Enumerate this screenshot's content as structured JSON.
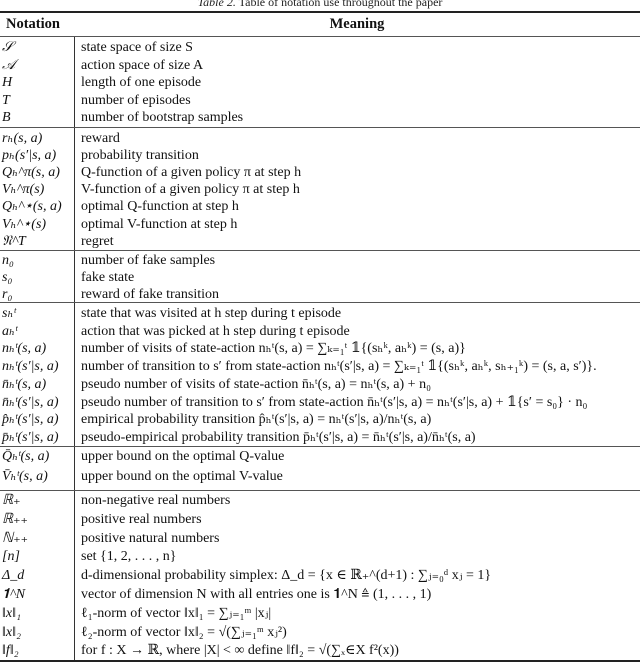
{
  "caption": {
    "label": "Table 2.",
    "text": "Table of notation use throughout the paper"
  },
  "header": {
    "notation": "Notation",
    "meaning": "Meaning"
  },
  "groups": [
    {
      "rows": [
        {
          "symbol": "𝒮",
          "meaning": "state space of size S"
        },
        {
          "symbol": "𝒜",
          "meaning": "action space of size A"
        },
        {
          "symbol": "H",
          "meaning": "length of one episode"
        },
        {
          "symbol": "T",
          "meaning": "number of episodes"
        },
        {
          "symbol": "B",
          "meaning": "number of bootstrap samples"
        }
      ]
    },
    {
      "rows": [
        {
          "symbol": "rₕ(s, a)",
          "meaning": "reward"
        },
        {
          "symbol": "pₕ(s′|s, a)",
          "meaning": "probability transition"
        },
        {
          "symbol": "Qₕ^π(s, a)",
          "meaning": "Q-function of a given policy π at step h"
        },
        {
          "symbol": "Vₕ^π(s)",
          "meaning": "V-function of a given policy π at step h"
        },
        {
          "symbol": "Qₕ^⋆(s, a)",
          "meaning": "optimal Q-function at step h"
        },
        {
          "symbol": "Vₕ^⋆(s)",
          "meaning": "optimal V-function at step h"
        },
        {
          "symbol": "𝔑^T",
          "meaning": "regret"
        }
      ]
    },
    {
      "rows": [
        {
          "symbol": "n₀",
          "meaning": "number of fake samples"
        },
        {
          "symbol": "s₀",
          "meaning": "fake state"
        },
        {
          "symbol": "r₀",
          "meaning": "reward of fake transition"
        }
      ]
    },
    {
      "rows": [
        {
          "symbol": "sₕᵗ",
          "meaning": "state that was visited at h step during t episode"
        },
        {
          "symbol": "aₕᵗ",
          "meaning": "action that was picked at h step during t episode"
        },
        {
          "symbol": "nₕᵗ(s, a)",
          "meaning": "number of visits of state-action nₕᵗ(s, a) = ∑ₖ₌₁ᵗ 𝟙{(sₕᵏ, aₕᵏ) = (s, a)}"
        },
        {
          "symbol": "nₕᵗ(s′|s, a)",
          "meaning": "number of transition to s′ from state-action nₕᵗ(s′|s, a) = ∑ₖ₌₁ᵗ 𝟙{(sₕᵏ, aₕᵏ, sₕ₊₁ᵏ) = (s, a, s′)}."
        },
        {
          "symbol": "n̄ₕᵗ(s, a)",
          "meaning": "pseudo number of visits of state-action n̄ₕᵗ(s, a) = nₕᵗ(s, a) + n₀"
        },
        {
          "symbol": "n̄ₕᵗ(s′|s, a)",
          "meaning": "pseudo number of transition to s′ from state-action n̄ₕᵗ(s′|s, a) = nₕᵗ(s′|s, a) + 𝟙{s′ = s₀} · n₀"
        },
        {
          "symbol": "p̂ₕᵗ(s′|s, a)",
          "meaning": "empirical probability transition p̂ₕᵗ(s′|s, a) = nₕᵗ(s′|s, a)/nₕᵗ(s, a)"
        },
        {
          "symbol": "p̄ₕᵗ(s′|s, a)",
          "meaning": "pseudo-empirical probability transition p̄ₕᵗ(s′|s, a) = n̄ₕᵗ(s′|s, a)/n̄ₕᵗ(s, a)"
        }
      ]
    },
    {
      "rows": [
        {
          "symbol": "Q̄ₕᵗ(s, a)",
          "meaning": "upper bound on the optimal Q-value"
        },
        {
          "symbol": "V̄ₕᵗ(s, a)",
          "meaning": "upper bound on the optimal V-value"
        }
      ]
    },
    {
      "rows": [
        {
          "symbol": "ℝ₊",
          "meaning": "non-negative real numbers"
        },
        {
          "symbol": "ℝ₊₊",
          "meaning": "positive real numbers"
        },
        {
          "symbol": "ℕ₊₊",
          "meaning": "positive natural numbers"
        },
        {
          "symbol": "[n]",
          "meaning": "set {1, 2, . . . , n}"
        },
        {
          "symbol": "Δ_d",
          "meaning": "d-dimensional probability simplex: Δ_d = {x ∈ ℝ₊^(d+1) : ∑ⱼ₌₀ᵈ xⱼ = 1}"
        },
        {
          "symbol": "𝟏^N",
          "meaning": "vector of dimension N with all entries one is 𝟏^N ≜ (1, . . . , 1)"
        },
        {
          "symbol": "‖x‖₁",
          "meaning": "ℓ₁-norm of vector ‖x‖₁ = ∑ⱼ₌₁ᵐ |xⱼ|"
        },
        {
          "symbol": "‖x‖₂",
          "meaning": "ℓ₂-norm of vector ‖x‖₂ = √(∑ⱼ₌₁ᵐ xⱼ²)"
        },
        {
          "symbol": "‖f‖₂",
          "meaning": "for f : X → ℝ, where |X| < ∞ define ‖f‖₂ = √(∑ₓ∈X f²(x))"
        }
      ]
    }
  ]
}
